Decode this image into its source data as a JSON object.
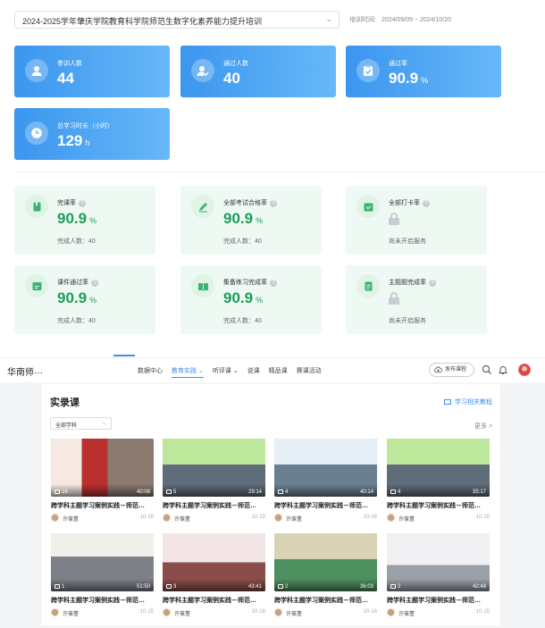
{
  "filter": {
    "training": "2024-2025学年肇庆学院教育科学院师范生数字化素养能力提升培训",
    "period_label": "培训时间:",
    "period_value": "2024/09/09 ~ 2024/10/20"
  },
  "stats": [
    {
      "label": "参训人数",
      "value": "44",
      "unit": "",
      "icon": "person-icon"
    },
    {
      "label": "通过人数",
      "value": "40",
      "unit": "",
      "icon": "person-check-icon"
    },
    {
      "label": "通过率",
      "value": "90.9",
      "unit": "%",
      "icon": "clipboard-icon"
    },
    {
      "label": "总学习时长（小时）",
      "value": "129",
      "unit": "h",
      "icon": "clock-icon"
    }
  ],
  "cards": [
    {
      "label": "完课率",
      "value": "90.9",
      "unit": "%",
      "sub": "完成人数：40",
      "locked": false
    },
    {
      "label": "全部考试合格率",
      "value": "90.9",
      "unit": "%",
      "sub": "完成人数：40",
      "locked": false
    },
    {
      "label": "全部打卡率",
      "value": "",
      "unit": "",
      "sub": "尚未开启服务",
      "locked": true
    },
    {
      "label": "课件通过率",
      "value": "90.9",
      "unit": "%",
      "sub": "完成人数：40",
      "locked": false
    },
    {
      "label": "集备练习完成率",
      "value": "90.9",
      "unit": "%",
      "sub": "完成人数：40",
      "locked": false
    },
    {
      "label": "主题题完成率",
      "value": "",
      "unit": "",
      "sub": "尚未开启服务",
      "locked": true
    }
  ],
  "nav": {
    "brand": "华南师···",
    "items": [
      {
        "label": "数据中心",
        "active": false
      },
      {
        "label": "教育实践 ⌄",
        "active": true
      },
      {
        "label": "听评课 ⌄",
        "active": false
      },
      {
        "label": "说课",
        "active": false
      },
      {
        "label": "精品课",
        "active": false
      },
      {
        "label": "赛课活动",
        "active": false
      }
    ],
    "publish": "发布课程"
  },
  "section": {
    "title": "实录课",
    "guide": "学习相关教程",
    "subject": "全部学科",
    "more": "更多 >"
  },
  "courses": [
    {
      "count": "16",
      "duration": "40:08",
      "title": "跨学科主题学习案例实践－师范…",
      "author": "许葆董",
      "date": "10-16",
      "theme": "red"
    },
    {
      "count": "5",
      "duration": "29:14",
      "title": "跨学科主题学习案例实践－师范…",
      "author": "许葆董",
      "date": "10-15",
      "theme": "green"
    },
    {
      "count": "4",
      "duration": "40:14",
      "title": "跨学科主题学习案例实践－师范…",
      "author": "许葆董",
      "date": "10-16",
      "theme": "blue"
    },
    {
      "count": "4",
      "duration": "35:17",
      "title": "跨学科主题学习案例实践－师范…",
      "author": "许葆董",
      "date": "10-15",
      "theme": "green"
    },
    {
      "count": "1",
      "duration": "51:50",
      "title": "跨学科主题学习案例实践－师范…",
      "author": "许葆董",
      "date": "10-15",
      "theme": "classroom"
    },
    {
      "count": "3",
      "duration": "43:41",
      "title": "跨学科主题学习案例实践－师范…",
      "author": "许葆董",
      "date": "10-16",
      "theme": "pink"
    },
    {
      "count": "2",
      "duration": "36:03",
      "title": "跨学科主题学习案例实践－师范…",
      "author": "许葆董",
      "date": "10-16",
      "theme": "yellow"
    },
    {
      "count": "2",
      "duration": "42:48",
      "title": "跨学科主题学习案例实践－师范…",
      "author": "许葆董",
      "date": "10-15",
      "theme": "gray"
    }
  ],
  "colors": {
    "accent": "#3f8ef0",
    "success": "#1a9e5a",
    "card_bg": "#eff9f3"
  }
}
